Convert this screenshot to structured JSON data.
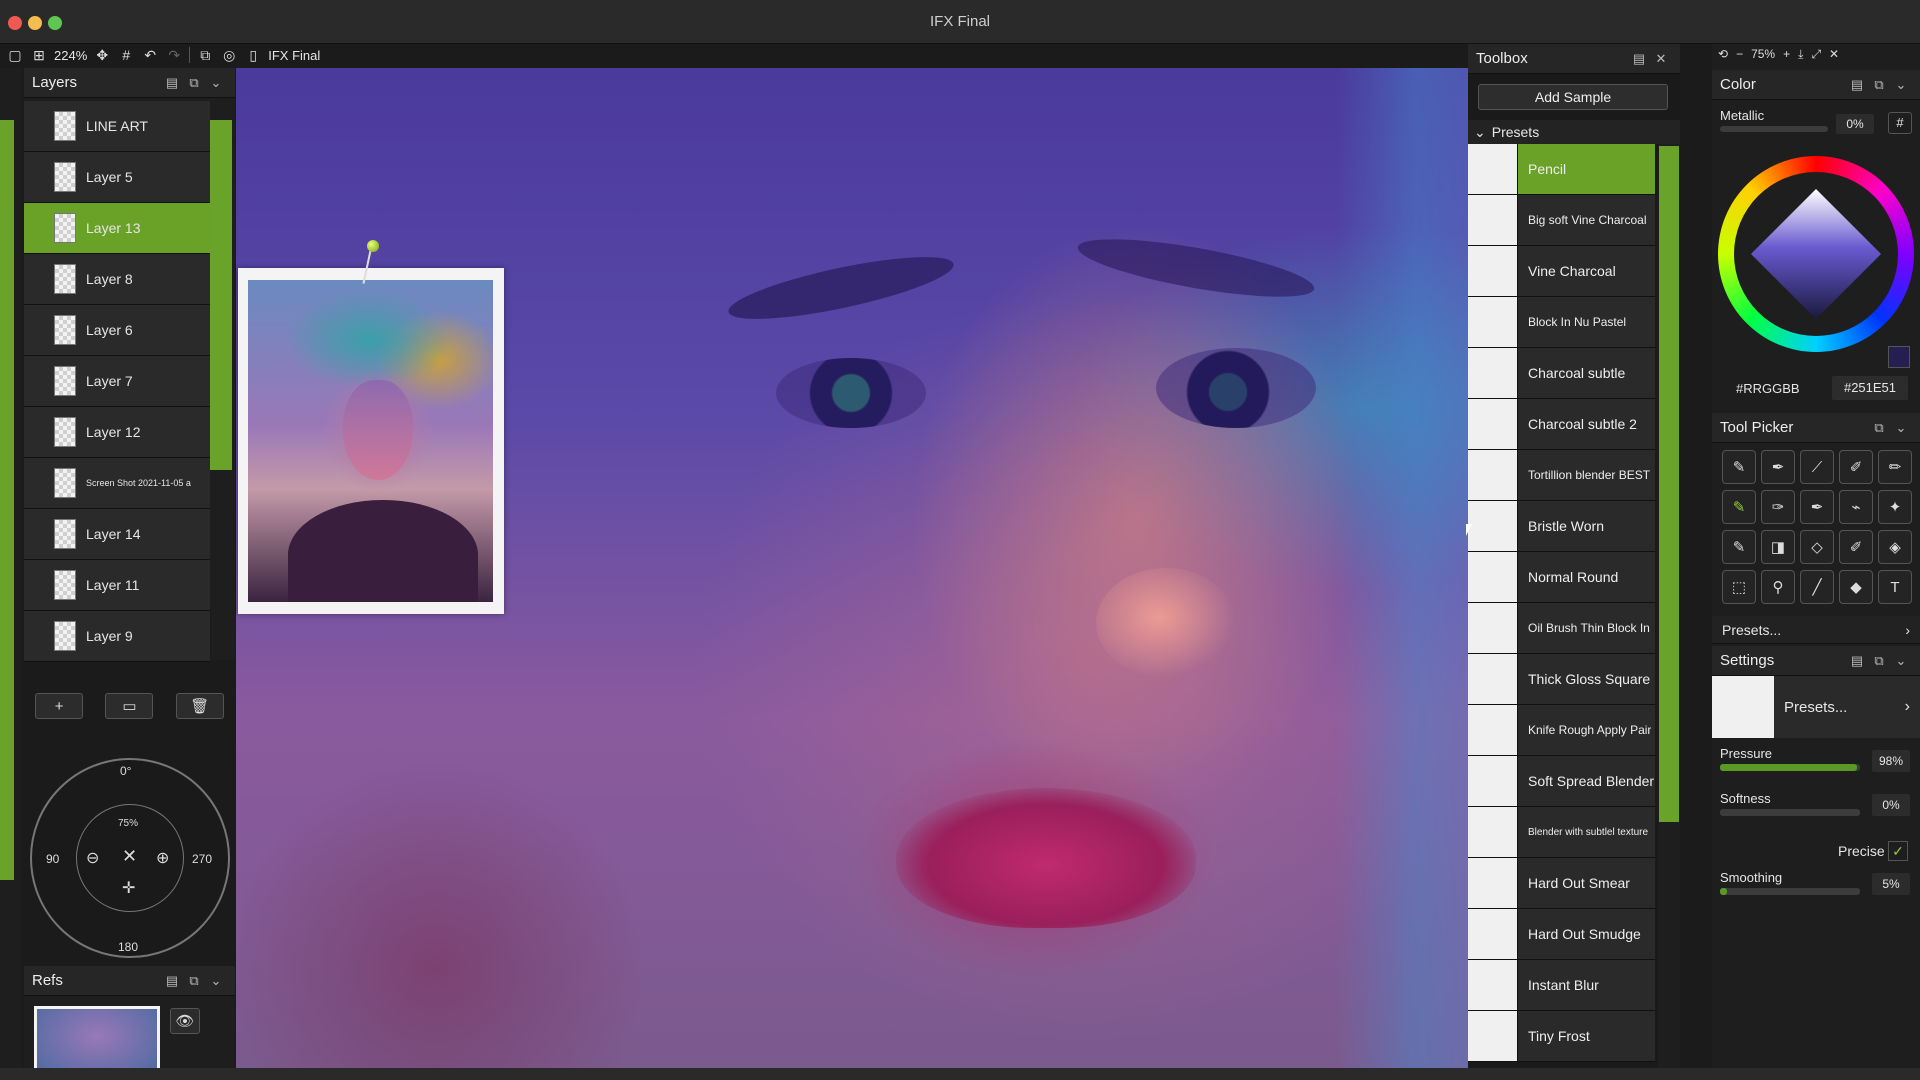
{
  "window": {
    "title": "IFX Final"
  },
  "toolbar": {
    "zoom": "224%",
    "doc_name": "IFX Final"
  },
  "layers": {
    "title": "Layers",
    "items": [
      {
        "name": "LINE ART",
        "active": false,
        "small": false
      },
      {
        "name": "Layer 5",
        "active": false,
        "small": false
      },
      {
        "name": "Layer 13",
        "active": true,
        "small": false
      },
      {
        "name": "Layer 8",
        "active": false,
        "small": false
      },
      {
        "name": "Layer 6",
        "active": false,
        "small": false
      },
      {
        "name": "Layer 7",
        "active": false,
        "small": false
      },
      {
        "name": "Layer 12",
        "active": false,
        "small": false
      },
      {
        "name": "Screen Shot 2021-11-05 a",
        "active": false,
        "small": true
      },
      {
        "name": "Layer 14",
        "active": false,
        "small": false
      },
      {
        "name": "Layer 11",
        "active": false,
        "small": false
      },
      {
        "name": "Layer 9",
        "active": false,
        "small": false
      }
    ]
  },
  "navigator": {
    "top": "0°",
    "left": "90",
    "right": "270",
    "bottom": "180",
    "zoom": "75%"
  },
  "refs": {
    "title": "Refs"
  },
  "toolbox": {
    "title": "Toolbox",
    "add_sample": "Add Sample",
    "presets_label": "Presets",
    "presets": [
      {
        "name": "Pencil",
        "active": true,
        "size": ""
      },
      {
        "name": "Big soft Vine Charcoal",
        "active": false,
        "size": "sm"
      },
      {
        "name": "Vine Charcoal",
        "active": false,
        "size": ""
      },
      {
        "name": "Block In Nu Pastel",
        "active": false,
        "size": "sm"
      },
      {
        "name": "Charcoal subtle",
        "active": false,
        "size": ""
      },
      {
        "name": "Charcoal subtle 2",
        "active": false,
        "size": ""
      },
      {
        "name": "Tortillion blender BEST",
        "active": false,
        "size": "sm"
      },
      {
        "name": "Bristle Worn",
        "active": false,
        "size": ""
      },
      {
        "name": "Normal Round",
        "active": false,
        "size": ""
      },
      {
        "name": "Oil Brush Thin Block In",
        "active": false,
        "size": "sm"
      },
      {
        "name": "Thick Gloss Square",
        "active": false,
        "size": ""
      },
      {
        "name": "Knife Rough Apply Pair",
        "active": false,
        "size": "sm"
      },
      {
        "name": "Soft Spread Blender",
        "active": false,
        "size": ""
      },
      {
        "name": "Blender with subtlel texture",
        "active": false,
        "size": "xs"
      },
      {
        "name": "Hard Out Smear",
        "active": false,
        "size": ""
      },
      {
        "name": "Hard Out Smudge",
        "active": false,
        "size": ""
      },
      {
        "name": "Instant Blur",
        "active": false,
        "size": ""
      },
      {
        "name": "Tiny Frost",
        "active": false,
        "size": ""
      }
    ]
  },
  "view": {
    "zoom": "75%"
  },
  "color": {
    "title": "Color",
    "metallic_label": "Metallic",
    "metallic_value": "0%",
    "hash_button": "#",
    "hex_label": "#RRGGBB",
    "hex_value": "#251E51",
    "current_color": "#251e51"
  },
  "tool_picker": {
    "title": "Tool Picker"
  },
  "presets_link": "Presets...",
  "settings": {
    "title": "Settings",
    "presets": "Presets...",
    "pressure_label": "Pressure",
    "pressure_value": "98%",
    "pressure_level": 0.98,
    "softness_label": "Softness",
    "softness_value": "0%",
    "softness_level": 0.0,
    "precise_label": "Precise",
    "smoothing_label": "Smoothing",
    "smoothing_value": "5%",
    "smoothing_level": 0.05
  }
}
